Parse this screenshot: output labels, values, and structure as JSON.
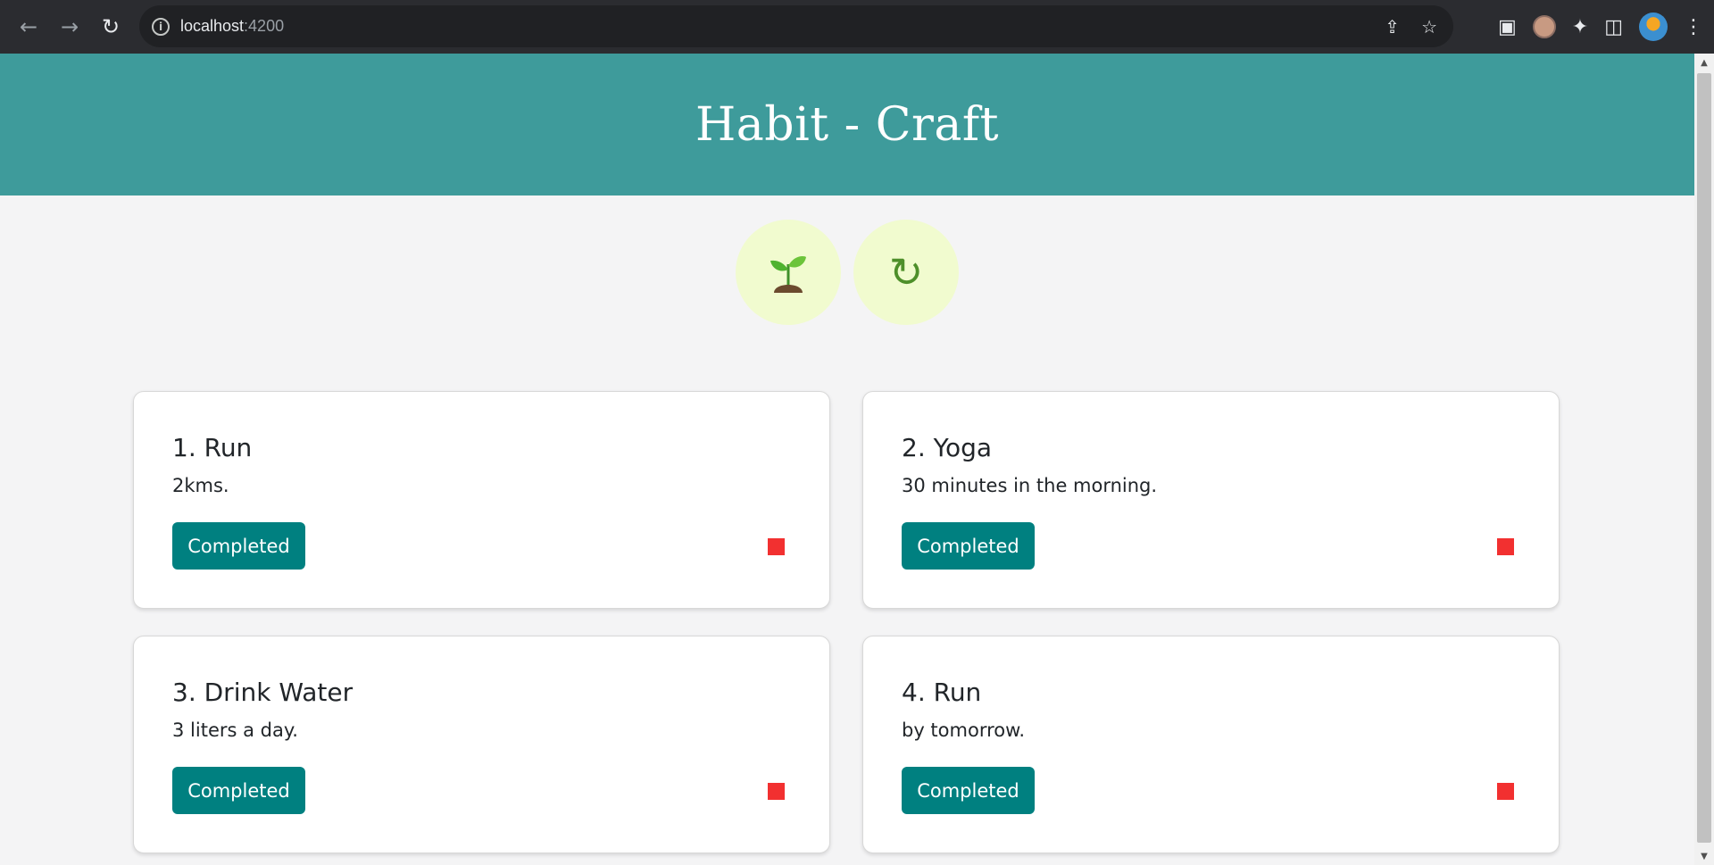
{
  "browser": {
    "url_host": "localhost",
    "url_port": ":4200"
  },
  "app": {
    "title": "Habit - Craft"
  },
  "actions": {
    "add_icon": "sprout-icon",
    "refresh_icon": "refresh-icon",
    "refresh_glyph": "↻"
  },
  "colors": {
    "header_bg": "#3e9b9b",
    "button_bg": "#008080",
    "circle_bg": "#f1fbcf",
    "status_incomplete": "#f23030"
  },
  "habits": [
    {
      "title": "1. Run",
      "description": "2kms.",
      "button_label": "Completed"
    },
    {
      "title": "2. Yoga",
      "description": "30 minutes in the morning.",
      "button_label": "Completed"
    },
    {
      "title": "3. Drink Water",
      "description": "3 liters a day.",
      "button_label": "Completed"
    },
    {
      "title": "4. Run",
      "description": "by tomorrow.",
      "button_label": "Completed"
    }
  ]
}
